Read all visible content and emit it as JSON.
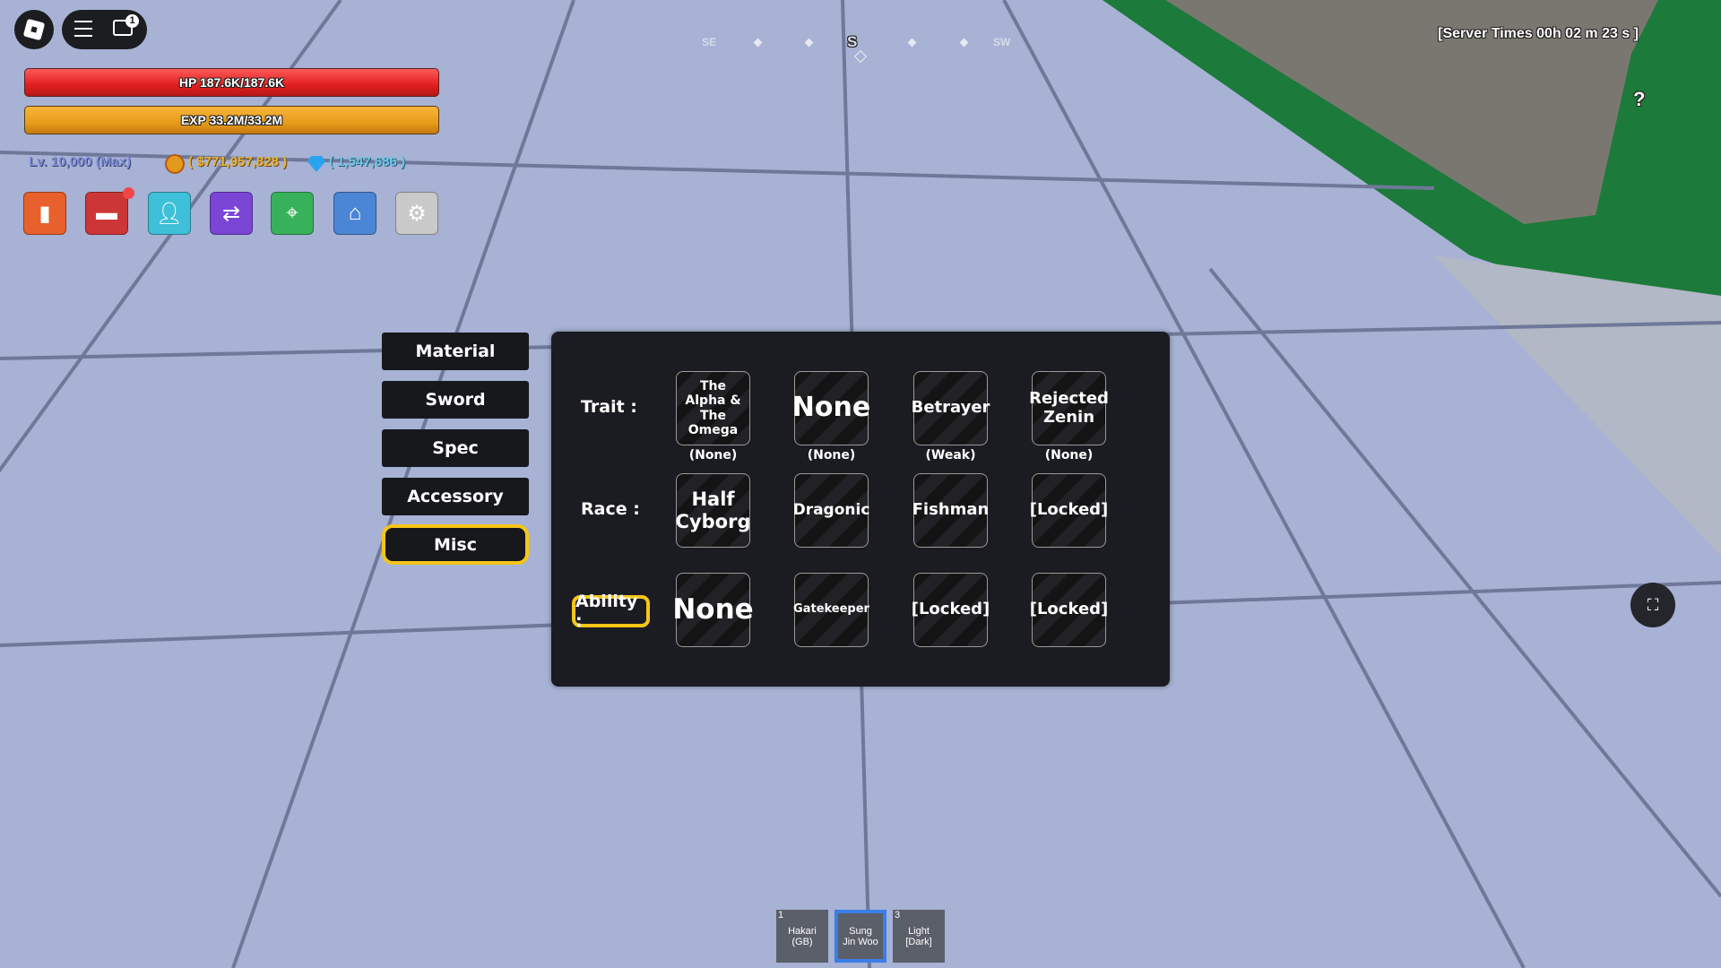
{
  "top": {
    "chat_badge": "1"
  },
  "compass": {
    "center": "S",
    "left": "SE",
    "right": "SW"
  },
  "server_time": "[Server Times 00h 02 m 23 s ]",
  "help": "?",
  "player": {
    "hp_label": "HP 187.6K/187.6K",
    "hp_fraction": 1.0,
    "exp_label": "EXP 33.2M/33.2M",
    "exp_fraction": 1.0,
    "level": "Lv. 10,000 (Max)",
    "money": "( $771,957,828 )",
    "gems": "( 1,547,686 )"
  },
  "hud_buttons": [
    {
      "icon": "stats-icon",
      "color": "#e8602c"
    },
    {
      "icon": "inventory-box-icon",
      "color": "#cc3636"
    },
    {
      "icon": "profile-icon",
      "color": "#3ec0d8"
    },
    {
      "icon": "trade-arrows-icon",
      "color": "#7b45d6"
    },
    {
      "icon": "map-pin-icon",
      "color": "#38b25a"
    },
    {
      "icon": "shop-icon",
      "color": "#4b86d6"
    },
    {
      "icon": "settings-gear-icon",
      "color": "#c9c9c9"
    }
  ],
  "categories": [
    "Material",
    "Sword",
    "Spec",
    "Accessory",
    "Misc"
  ],
  "selected_category": "Misc",
  "panel": {
    "trait_label": "Trait :",
    "race_label": "Race :",
    "ability_label": "Ability :",
    "traits": [
      {
        "name": "The Alpha & The Omega",
        "grade": "(None)"
      },
      {
        "name": "None",
        "grade": "(None)"
      },
      {
        "name": "Betrayer",
        "grade": "(Weak)"
      },
      {
        "name": "Rejected Zenin",
        "grade": "(None)"
      }
    ],
    "races": [
      "Half Cyborg",
      "Dragonic",
      "Fishman",
      "[Locked]"
    ],
    "abilities": [
      "None",
      "Gatekeeper",
      "[Locked]",
      "[Locked]"
    ]
  },
  "hotbar": [
    {
      "key": "1",
      "label": "Hakari (GB)"
    },
    {
      "key": "",
      "label": "Sung Jin Woo",
      "selected": true
    },
    {
      "key": "3",
      "label": "Light [Dark]"
    }
  ],
  "colors": {
    "accent": "#f5c518",
    "hp": "#e01e1e",
    "exp": "#e89c1a",
    "hotbar_selected": "#3a7ee8"
  }
}
